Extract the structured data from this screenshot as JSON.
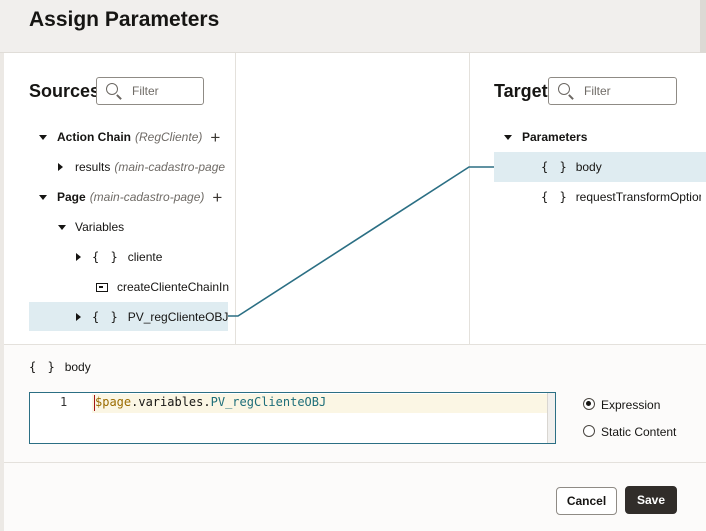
{
  "dialog": {
    "title": "Assign Parameters"
  },
  "sources": {
    "title": "Sources",
    "filter_placeholder": "Filter",
    "tree": {
      "action_chain": {
        "label": "Action Chain",
        "qualifier": "(RegCliente)",
        "add": "+"
      },
      "results": {
        "label": "results",
        "qualifier": "(main-cadastro-page"
      },
      "page": {
        "label": "Page",
        "qualifier": "(main-cadastro-page)",
        "add": "+"
      },
      "variables": {
        "label": "Variables"
      },
      "cliente": {
        "brace": "{ }",
        "label": "cliente"
      },
      "create_chain": {
        "label": "createClienteChainIn"
      },
      "pv_obj": {
        "brace": "{ }",
        "label": "PV_regClienteOBJ"
      }
    }
  },
  "target": {
    "title": "Target",
    "filter_placeholder": "Filter",
    "tree": {
      "parameters": {
        "label": "Parameters"
      },
      "body": {
        "brace": "{ }",
        "label": "body"
      },
      "request_transform": {
        "brace": "{ }",
        "label": "requestTransformOptions"
      }
    }
  },
  "detail": {
    "selected_brace": "{ }",
    "selected_label": "body",
    "line_number": "1",
    "code": {
      "page": "$page",
      "dot1": ".",
      "variables": "variables",
      "dot2": ".",
      "var": "PV_regClienteOBJ"
    },
    "mode_options": [
      {
        "label": "Expression",
        "selected": true
      },
      {
        "label": "Static Content",
        "selected": false
      }
    ]
  },
  "footer": {
    "cancel": "Cancel",
    "save": "Save"
  },
  "colors": {
    "accent": "#2b6f84",
    "selection": "#dfecf1",
    "primary_button": "#312d2a"
  }
}
